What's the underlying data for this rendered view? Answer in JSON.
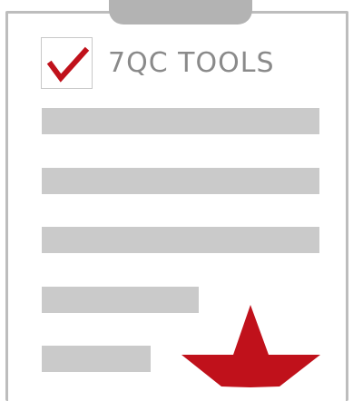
{
  "header": {
    "title": "7QC TOOLS"
  },
  "checkbox": {
    "checked": true,
    "icon": "checkmark-icon"
  },
  "list": {
    "item_count": 5
  },
  "colors": {
    "check": "#c0111b",
    "star": "#c0111b",
    "placeholder": "#cacaca",
    "border": "#bdbdbd",
    "title": "#8a8a8a"
  },
  "icons": {
    "tab": "clipboard-clip-icon",
    "star": "star-icon"
  }
}
